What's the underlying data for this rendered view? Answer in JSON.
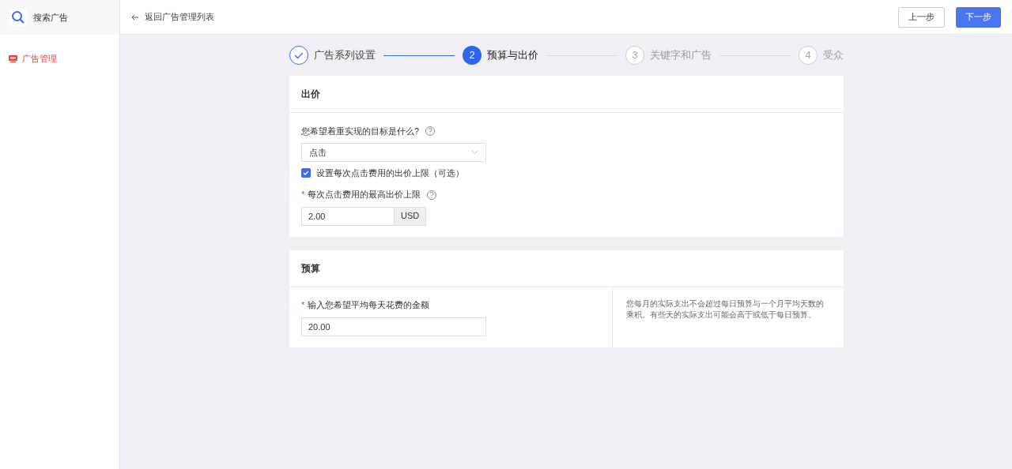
{
  "app": {
    "title": "搜索广告"
  },
  "sidebar": {
    "items": [
      {
        "label": "广告管理",
        "selected": true
      }
    ]
  },
  "header": {
    "back_link": "返回广告管理列表",
    "buttons": [
      {
        "label": "上一步",
        "kind": "secondary"
      },
      {
        "label": "下一步",
        "kind": "primary"
      }
    ]
  },
  "steps": [
    {
      "label": "广告系列设置",
      "completed": true,
      "selected": false
    },
    {
      "number": "2",
      "label": "预算与出价",
      "completed": false,
      "selected": true
    },
    {
      "number": "3",
      "label": "关键字和广告",
      "completed": false,
      "selected": false
    },
    {
      "number": "4",
      "label": "受众",
      "completed": false,
      "selected": false
    }
  ],
  "bid": {
    "title": "出价",
    "goal_label": "您希望着重实现的目标是什么?",
    "goal_value": "点击",
    "cap_checkbox": {
      "label": "设置每次点击费用的出价上限（可选）",
      "checked": true
    },
    "max_required_mark": "*",
    "max_label": "每次点击费用的最高出价上限",
    "max_value": "2.00",
    "currency": "USD"
  },
  "budget": {
    "title": "预算",
    "amount_required_mark": "*",
    "amount_label": "输入您希望平均每天花费的金额",
    "amount_value": "20.00",
    "note": "您每月的实际支出不会超过每日预算与一个月平均天数的乘积。有些天的实际支出可能会高于或低于每日预算。"
  }
}
